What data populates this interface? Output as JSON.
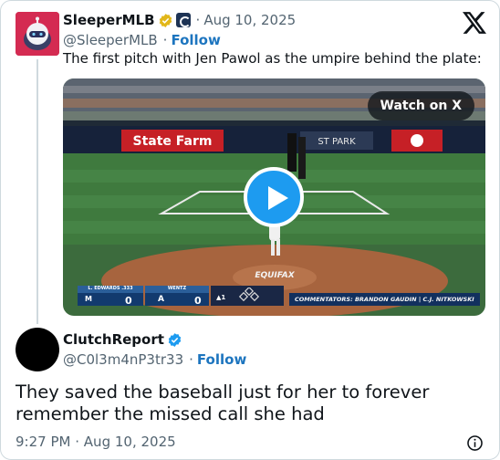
{
  "quoted_tweet": {
    "display_name": "SleeperMLB",
    "date": "Aug 10, 2025",
    "handle": "@SleeperMLB",
    "follow_label": "Follow",
    "text": "The first pitch with Jen Pawol as the umpire behind the plate:",
    "video": {
      "watch_label": "Watch on X",
      "away_team": "L. EDWARDS .333",
      "away_score": "0",
      "home_team": "WENTZ",
      "home_score": "0",
      "inning": "▲1",
      "commentators": "COMMENTATORS: BRANDON GAUDIN | C.J. NITKOWSKI",
      "signage": [
        "State Farm",
        "ST PARK",
        "EQUIFAX"
      ]
    }
  },
  "main_tweet": {
    "display_name": "ClutchReport",
    "handle": "@C0l3m4nP3tr33",
    "follow_label": "Follow",
    "text": "They saved the baseball just for her to forever remember the missed call she had",
    "time": "9:27 PM",
    "date": "Aug 10, 2025"
  },
  "separator": "·",
  "colors": {
    "link": "#1d75bf",
    "verified_gold": "#e2b719",
    "verified_blue": "#1d9bf0",
    "muted": "#536471",
    "brand_red": "#d42b52"
  },
  "icons": [
    "x-logo-icon",
    "gold-verified-icon",
    "affiliate-badge-icon",
    "blue-verified-icon",
    "info-icon",
    "play-icon"
  ]
}
